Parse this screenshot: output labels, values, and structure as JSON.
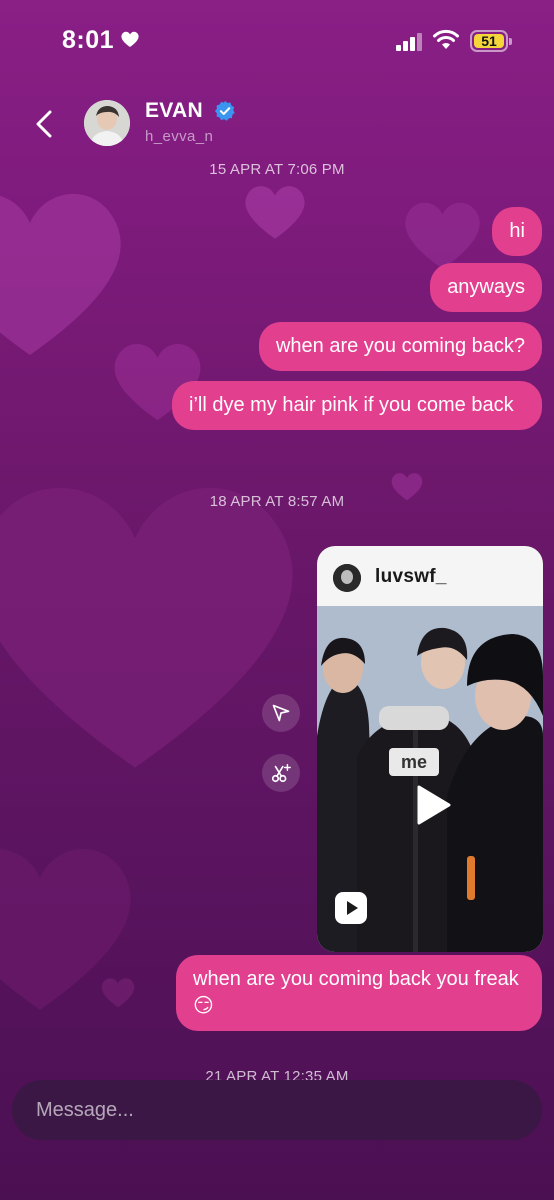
{
  "status_bar": {
    "time": "8:01",
    "battery": "51",
    "battery_color": "#f4d63b"
  },
  "header": {
    "name": "EVAN",
    "handle": "h_evva_n",
    "verified": true
  },
  "theme": {
    "bubble_color": "#e33f8f",
    "background_top": "#8a1f86",
    "background_bottom": "#4b1052"
  },
  "messages": {
    "timestamp_1": "15 APR AT 7:06 PM",
    "m1": "hi",
    "m2": "anyways",
    "m3": "when are you coming back?",
    "m4": "i’ll dye my hair pink if you come back",
    "timestamp_2": "18 APR AT 8:57 AM",
    "shared_reel": {
      "username": "luvswf_",
      "caption": "me"
    },
    "m5": "when are you coming back you freak😏",
    "timestamp_3": "21 APR AT 12:35 AM"
  },
  "composer": {
    "placeholder": "Message..."
  }
}
